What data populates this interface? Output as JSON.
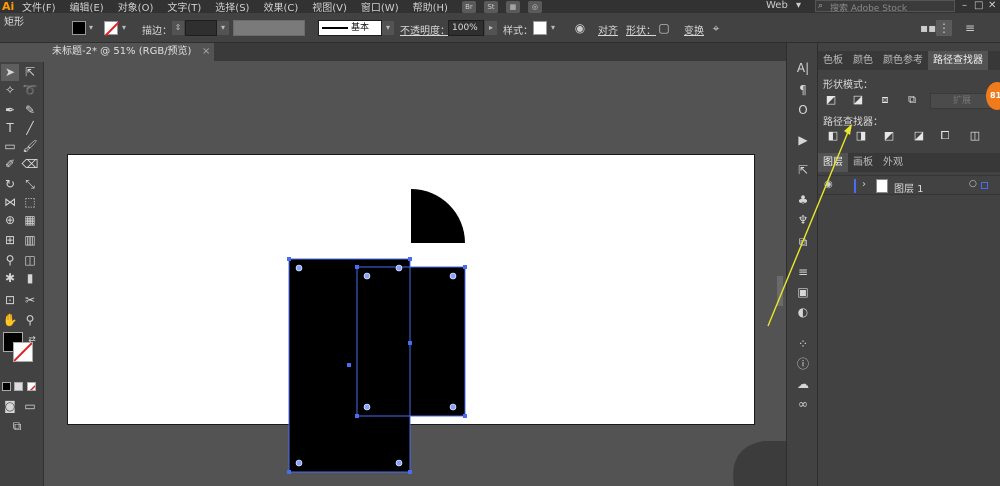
{
  "menubar": {
    "logo": "Ai",
    "items": [
      "文件(F)",
      "编辑(E)",
      "对象(O)",
      "文字(T)",
      "选择(S)",
      "效果(C)",
      "视图(V)",
      "窗口(W)",
      "帮助(H)"
    ],
    "app_buttons": [
      "Br",
      "St"
    ],
    "workspace": "Web",
    "search_placeholder": "搜索 Adobe Stock",
    "window_buttons": [
      "–",
      "□",
      "✕"
    ]
  },
  "controlbar": {
    "object_label": "矩形",
    "stroke_label": "描边：",
    "brush_label": "基本",
    "opacity_label": "不透明度：",
    "opacity_value": "100%",
    "style_label": "样式：",
    "align_label": "对齐",
    "shape_label": "形状：",
    "transform_label": "变换",
    "fill_color": "#000000"
  },
  "document_tab": {
    "title": "未标题-2* @ 51% (RGB/预览)",
    "close": "×"
  },
  "panels": {
    "top_tabs": [
      "色板",
      "颜色",
      "颜色参考",
      "路径查找器"
    ],
    "shape_modes_title": "形状模式：",
    "expand_button": "扩展",
    "pathfinder_title": "路径查找器：",
    "layer_tabs": [
      "图层",
      "画板",
      "外观"
    ],
    "layer_name": "图层 1"
  },
  "badge": "81",
  "colors": {
    "accent": "#f07b1d",
    "selection": "#4a6cf0",
    "arrow": "#e8e82a"
  }
}
